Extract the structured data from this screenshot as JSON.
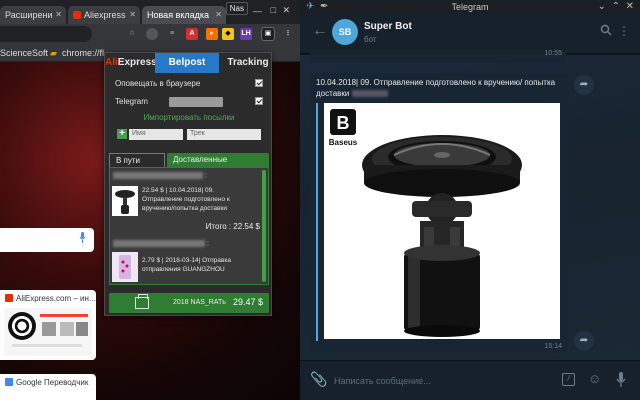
{
  "chrome": {
    "tabs": [
      {
        "label": "Расширени",
        "favicon_color": "#5f6368"
      },
      {
        "label": "Aliexpress",
        "favicon_color": "#e62e04"
      },
      {
        "label": "Новая вкладка",
        "favicon_color": ""
      }
    ],
    "profile_name": "Nas",
    "bookmarks": [
      "ScienceSoft",
      "chrome://fl"
    ],
    "extension_badge": "LH"
  },
  "new_tab_page": {
    "aliexpress_card": {
      "title": "AliExpress.com – ин..."
    },
    "translate_card": {
      "title": "Google Переводчик"
    }
  },
  "popup": {
    "tabs": {
      "ali_prefix": "Ali",
      "ali_suffix": "Express",
      "belpost": "Belpost",
      "tracking": "Tracking"
    },
    "notify_label": "Оповещать в браузере",
    "notify_checked": true,
    "telegram_label": "Telegram",
    "telegram_checked": true,
    "import_link": "Импортировать посылки",
    "add_button": "+",
    "name_placeholder": "Имя",
    "track_placeholder": "Трек",
    "section_tabs": {
      "active": "В пути",
      "other": "Доставленные"
    },
    "items": [
      {
        "name_suffix": ":",
        "line1": "22.54 $ | 10.04.2018| 09.",
        "line2": "Отправление подготовлено к",
        "line3": "вручению/попытка доставки",
        "total": "Итого : 22.54 $"
      },
      {
        "name_suffix": ":",
        "line1": "2.79 $ | 2018-03-14| Отправка",
        "line2": "отправления GUANGZHOU"
      }
    ],
    "footer": {
      "text": "2018 NAS_RATь",
      "sum": "29.47 $"
    }
  },
  "telegram": {
    "window_title": "Telegram",
    "bot": {
      "avatar_initials": "SB",
      "name": "Super Bot",
      "status": "бот"
    },
    "prev_time": "10:55",
    "message": {
      "text": "10.04.2018| 09. Отправление подготовлено к вручению/ попытка доставки",
      "brand": "Baseus",
      "time": "15:14"
    },
    "composer_placeholder": "Написать сообщение..."
  }
}
